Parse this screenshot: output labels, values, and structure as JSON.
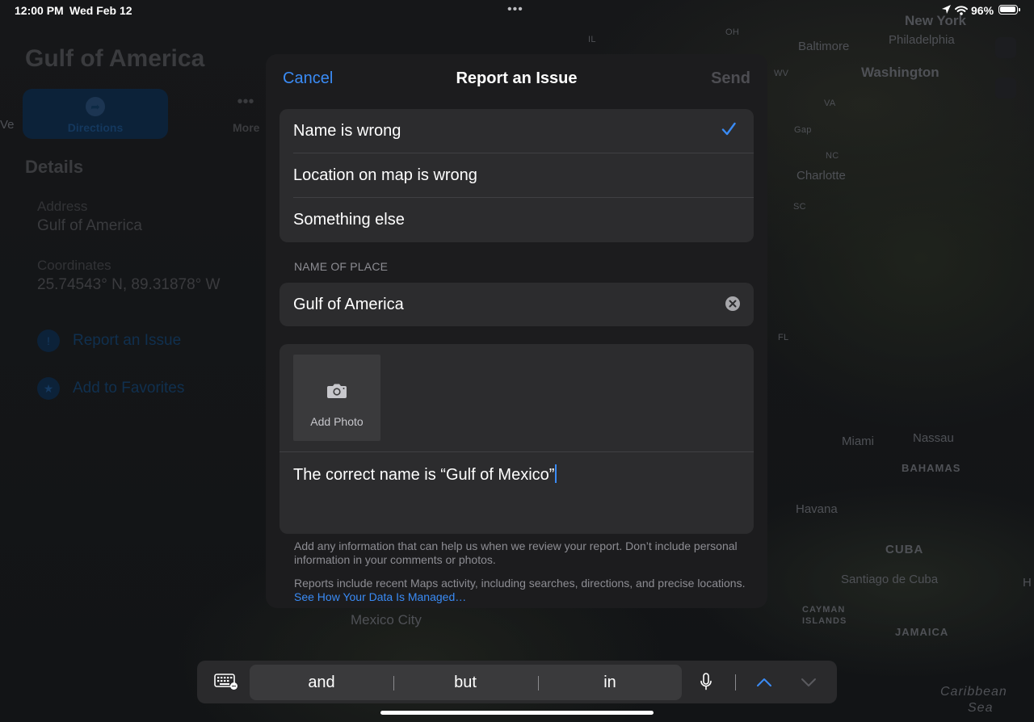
{
  "status_bar": {
    "time": "12:00 PM",
    "date": "Wed Feb 12",
    "dots": "•••",
    "battery_pct": "96%"
  },
  "background_card": {
    "title": "Gulf of America",
    "directions_label": "Directions",
    "more_label": "More",
    "details_heading": "Details",
    "address_label": "Address",
    "address_value": "Gulf of America",
    "coordinates_label": "Coordinates",
    "coordinates_value": "25.74543° N, 89.31878° W",
    "report_issue_label": "Report an Issue",
    "add_favorites_label": "Add to Favorites"
  },
  "map_labels": {
    "new_york": "New York",
    "philadelphia": "Philadelphia",
    "baltimore": "Baltimore",
    "washington": "Washington",
    "oh": "OH",
    "wv": "WV",
    "va": "VA",
    "nc": "NC",
    "sc": "SC",
    "fl": "FL",
    "il": "IL",
    "charlotte": "Charlotte",
    "gap": "Gap",
    "miami": "Miami",
    "nassau": "Nassau",
    "bahamas": "BAHAMAS",
    "havana": "Havana",
    "cuba": "CUBA",
    "santiago": "Santiago de Cuba",
    "cayman_1": "CAYMAN",
    "cayman_2": "ISLANDS",
    "jamaica": "JAMAICA",
    "mexico_city": "Mexico City",
    "caribbean_1": "Caribbean",
    "caribbean_2": "Sea",
    "edge_ve": "Ve",
    "edge_h": "H"
  },
  "dialog": {
    "cancel": "Cancel",
    "title": "Report an Issue",
    "send": "Send",
    "options": [
      {
        "label": "Name is wrong",
        "selected": true
      },
      {
        "label": "Location on map is wrong",
        "selected": false
      },
      {
        "label": "Something else",
        "selected": false
      }
    ],
    "name_section_header": "NAME OF PLACE",
    "name_value": "Gulf of America",
    "add_photo_label": "Add Photo",
    "comment_text": "The correct name is “Gulf of Mexico”",
    "help_text": "Add any information that can help us when we review your report. Don’t include personal information in your comments or photos.",
    "privacy_text": "Reports include recent Maps activity, including searches, directions, and precise locations.",
    "privacy_link": "See How Your Data Is Managed…"
  },
  "keyboard_bar": {
    "suggestions": [
      "and",
      "but",
      "in"
    ]
  },
  "colors": {
    "accent": "#3a8bf5",
    "dialog_bg": "#1c1c1e",
    "group_bg": "#2c2c2e",
    "disabled_text": "#4d4d52"
  },
  "icons": {
    "status": [
      "location-arrow-icon",
      "wifi-icon",
      "battery-icon"
    ],
    "dialog": [
      "checkmark-icon",
      "clear-text-icon",
      "camera-icon"
    ],
    "keyboard": [
      "keyboard-icon",
      "microphone-icon",
      "chevron-up-icon",
      "chevron-down-icon"
    ]
  }
}
